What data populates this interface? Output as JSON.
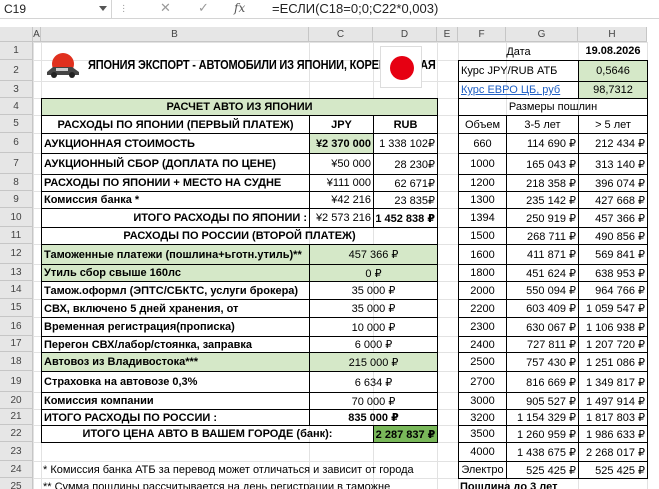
{
  "formula_bar": {
    "cell_ref": "C19",
    "formula": "=ЕСЛИ(C18=0;0;C22*0,003)"
  },
  "columns": [
    "A",
    "B",
    "C",
    "D",
    "E",
    "F",
    "G",
    "H"
  ],
  "rows": [
    "1",
    "2",
    "3",
    "4",
    "5",
    "6",
    "7",
    "8",
    "9",
    "10",
    "11",
    "12",
    "13",
    "14",
    "15",
    "16",
    "17",
    "18",
    "19",
    "20",
    "21",
    "22",
    "23",
    "24",
    "25"
  ],
  "title": "ЯПОНИЯ ЭКСПОРТ - АВТОМОБИЛИ ИЗ ЯПОНИИ, КОРЕИ И КИТАЯ",
  "colors": {
    "light_green": "#d5e8c8",
    "dark_green": "#79b85a",
    "link": "#1f5fc4",
    "flag_red": "#e60012"
  },
  "info": {
    "date_label": "Дата",
    "date_value": "19.08.2026",
    "jpy_label": "Курс JPY/RUB АТБ",
    "jpy_value": "0,5646",
    "eur_label": "Курс ЕВРО ЦБ, руб",
    "eur_value": "98,7312"
  },
  "japan": {
    "header": "РАСЧЕТ АВТО ИЗ ЯПОНИИ",
    "subheader": "РАСХОДЫ ПО ЯПОНИИ (ПЕРВЫЙ ПЛАТЕЖ)",
    "col_jpy": "JPY",
    "col_rub": "RUB",
    "rows": [
      {
        "label": "АУКЦИОННАЯ СТОИМОСТЬ",
        "jpy": "¥2 370 000",
        "rub": "1 338 102₽"
      },
      {
        "label": "АУКЦИОННЫЙ СБОР (ДОПЛАТА ПО ЦЕНЕ)",
        "jpy": "¥50 000",
        "rub": "28 230₽"
      },
      {
        "label": "РАСХОДЫ ПО ЯПОНИИ + МЕСТО НА СУДНЕ",
        "jpy": "¥111 000",
        "rub": "62 671₽"
      },
      {
        "label": "Комиссия банка *",
        "jpy": "¥42 216",
        "rub": "23 835₽"
      }
    ],
    "total_label": "ИТОГО РАСХОДЫ ПО ЯПОНИИ :",
    "total_jpy": "¥2 573 216",
    "total_rub": "1 452 838 ₽"
  },
  "russia": {
    "header": "РАСХОДЫ ПО РОССИИ (ВТОРОЙ ПЛАТЕЖ)",
    "rows": [
      {
        "label": "Таможенные платежи (пошлина+ьготн.утиль)**",
        "value": "457 366 ₽"
      },
      {
        "label": "Утиль сбор свыше 160лс",
        "value": "0 ₽"
      },
      {
        "label": "Тамож.оформл (ЭПТС/СБКТС, услуги брокера)",
        "value": "35 000 ₽"
      },
      {
        "label": "СВХ, включено 5 дней хранения, от",
        "value": "35 000 ₽"
      },
      {
        "label": "Временная регистрация(прописка)",
        "value": "10 000 ₽"
      },
      {
        "label": "Перегон СВХ/лабор/стоянка, заправка",
        "value": "6 000 ₽"
      },
      {
        "label": "Автовоз из Владивостока***",
        "value": "215 000 ₽"
      },
      {
        "label": "Страховка на автовозе 0,3%",
        "value": "6 634 ₽"
      },
      {
        "label": "Комиссия компании",
        "value": "70 000 ₽"
      }
    ],
    "total_label": "ИТОГО РАСХОДЫ ПО РОССИИ :",
    "total_value": "835 000 ₽",
    "grand_label": "ИТОГО ЦЕНА АВТО В ВАШЕМ ГОРОДЕ (банк):",
    "grand_value": "2 287 837 ₽"
  },
  "notes": {
    "n1": "* Комиссия банка АТБ за перевод может отличаться и зависит от города",
    "n2": "** Сумма пошлины рассчитывается на день регистрации в таможне"
  },
  "duties": {
    "header": "Размеры пошлин",
    "col_volume": "Объем",
    "col_35": "3-5 лет",
    "col_5plus": "> 5 лет",
    "rows": [
      [
        "660",
        "114 690 ₽",
        "212 434 ₽"
      ],
      [
        "1000",
        "165 043 ₽",
        "313 140 ₽"
      ],
      [
        "1200",
        "218 358 ₽",
        "396 074 ₽"
      ],
      [
        "1300",
        "235 142 ₽",
        "427 668 ₽"
      ],
      [
        "1394",
        "250 919 ₽",
        "457 366 ₽"
      ],
      [
        "1500",
        "268 711 ₽",
        "490 856 ₽"
      ],
      [
        "1600",
        "411 871 ₽",
        "569 841 ₽"
      ],
      [
        "1800",
        "451 624 ₽",
        "638 953 ₽"
      ],
      [
        "2000",
        "550 094 ₽",
        "964 766 ₽"
      ],
      [
        "2200",
        "603 409 ₽",
        "1 059 547 ₽"
      ],
      [
        "2300",
        "630 067 ₽",
        "1 106 938 ₽"
      ],
      [
        "2400",
        "727 811 ₽",
        "1 207 720 ₽"
      ],
      [
        "2500",
        "757 430 ₽",
        "1 251 086 ₽"
      ],
      [
        "2700",
        "816 669 ₽",
        "1 349 817 ₽"
      ],
      [
        "3000",
        "905 527 ₽",
        "1 497 914 ₽"
      ],
      [
        "3200",
        "1 154 329 ₽",
        "1 817 803 ₽"
      ],
      [
        "3500",
        "1 260 959 ₽",
        "1 986 633 ₽"
      ],
      [
        "4000",
        "1 438 675 ₽",
        "2 268 017 ₽"
      ],
      [
        "Электро",
        "525 425 ₽",
        "525 425 ₽"
      ]
    ],
    "footer": "Пошлина до 3 лет"
  }
}
